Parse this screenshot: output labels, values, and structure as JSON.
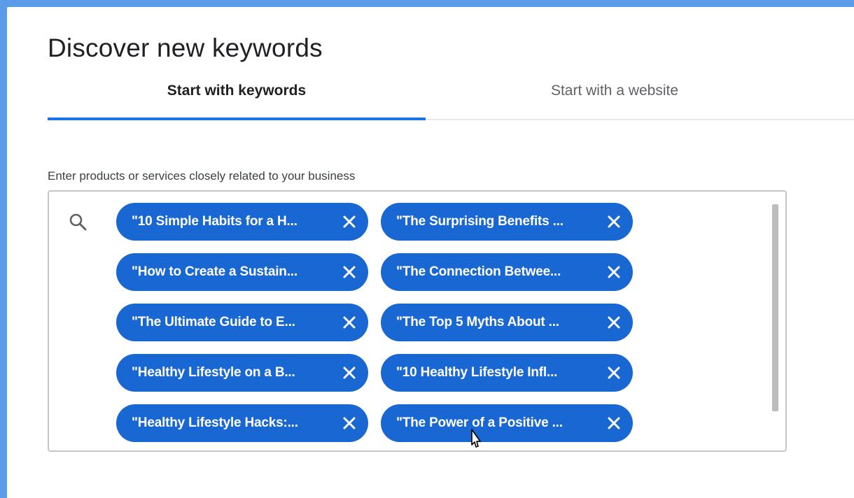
{
  "page": {
    "title": "Discover new keywords"
  },
  "tabs": [
    {
      "label": "Start with keywords",
      "selected": true
    },
    {
      "label": "Start with a website",
      "selected": false
    }
  ],
  "input": {
    "label": "Enter products or services closely related to your business",
    "icon": "search-icon"
  },
  "chips": [
    {
      "label": "\"10 Simple Habits for a H..."
    },
    {
      "label": "\"The Surprising Benefits ..."
    },
    {
      "label": "\"How to Create a Sustain..."
    },
    {
      "label": "\"The Connection Betwee..."
    },
    {
      "label": "\"The Ultimate Guide to E..."
    },
    {
      "label": "\"The Top 5 Myths About ..."
    },
    {
      "label": "\"Healthy Lifestyle on a B..."
    },
    {
      "label": "\"10 Healthy Lifestyle Infl..."
    },
    {
      "label": "\"Healthy Lifestyle Hacks:..."
    },
    {
      "label": "\"The Power of a Positive ..."
    }
  ],
  "colors": {
    "frame": "#5b9be8",
    "accent": "#1a73e8",
    "chip": "#1967d2"
  }
}
